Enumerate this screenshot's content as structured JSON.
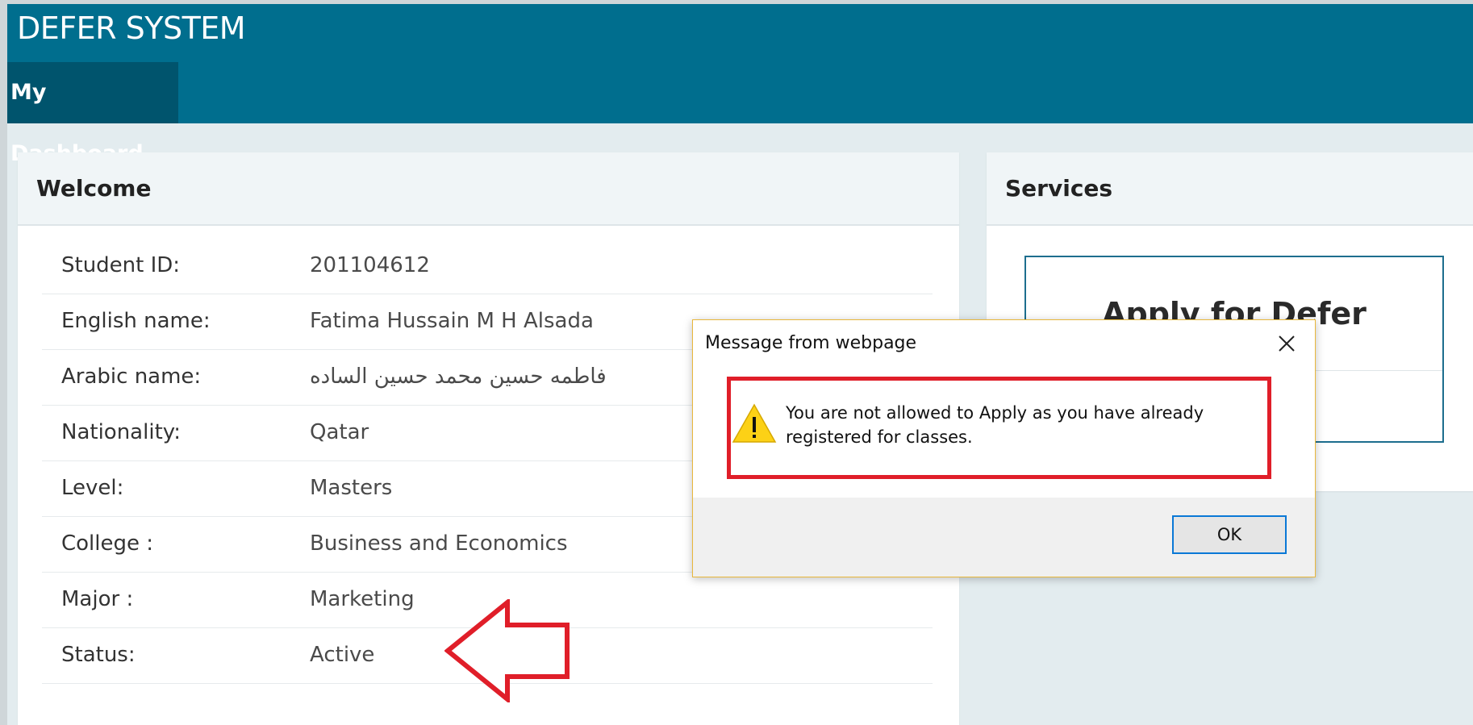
{
  "header": {
    "app_title": "DEFER SYSTEM",
    "nav": {
      "dashboard_label": "My Dashboard"
    }
  },
  "welcome": {
    "title": "Welcome",
    "rows": [
      {
        "label": "Student ID:",
        "value": "201104612"
      },
      {
        "label": "English name:",
        "value": "Fatima Hussain M H Alsada"
      },
      {
        "label": "Arabic name:",
        "value": "فاطمه حسين محمد حسين الساده"
      },
      {
        "label": "Nationality:",
        "value": "Qatar"
      },
      {
        "label": "Level:",
        "value": "Masters"
      },
      {
        "label": "College :",
        "value": "Business and Economics"
      },
      {
        "label": "Major :",
        "value": "Marketing"
      },
      {
        "label": "Status:",
        "value": "Active"
      }
    ]
  },
  "services": {
    "title": "Services",
    "card_title": "Apply for Defer"
  },
  "dialog": {
    "title": "Message from webpage",
    "message": "You are not allowed to Apply as you have already registered for classes.",
    "ok_label": "OK"
  },
  "colors": {
    "header_bg": "#006e8e",
    "nav_active_bg": "#00546d",
    "annotation_red": "#e01e29",
    "warning_yellow": "#fcd116"
  },
  "icons": {
    "close": "close-icon",
    "warning": "warning-icon",
    "annotation": "arrow-left-icon"
  }
}
